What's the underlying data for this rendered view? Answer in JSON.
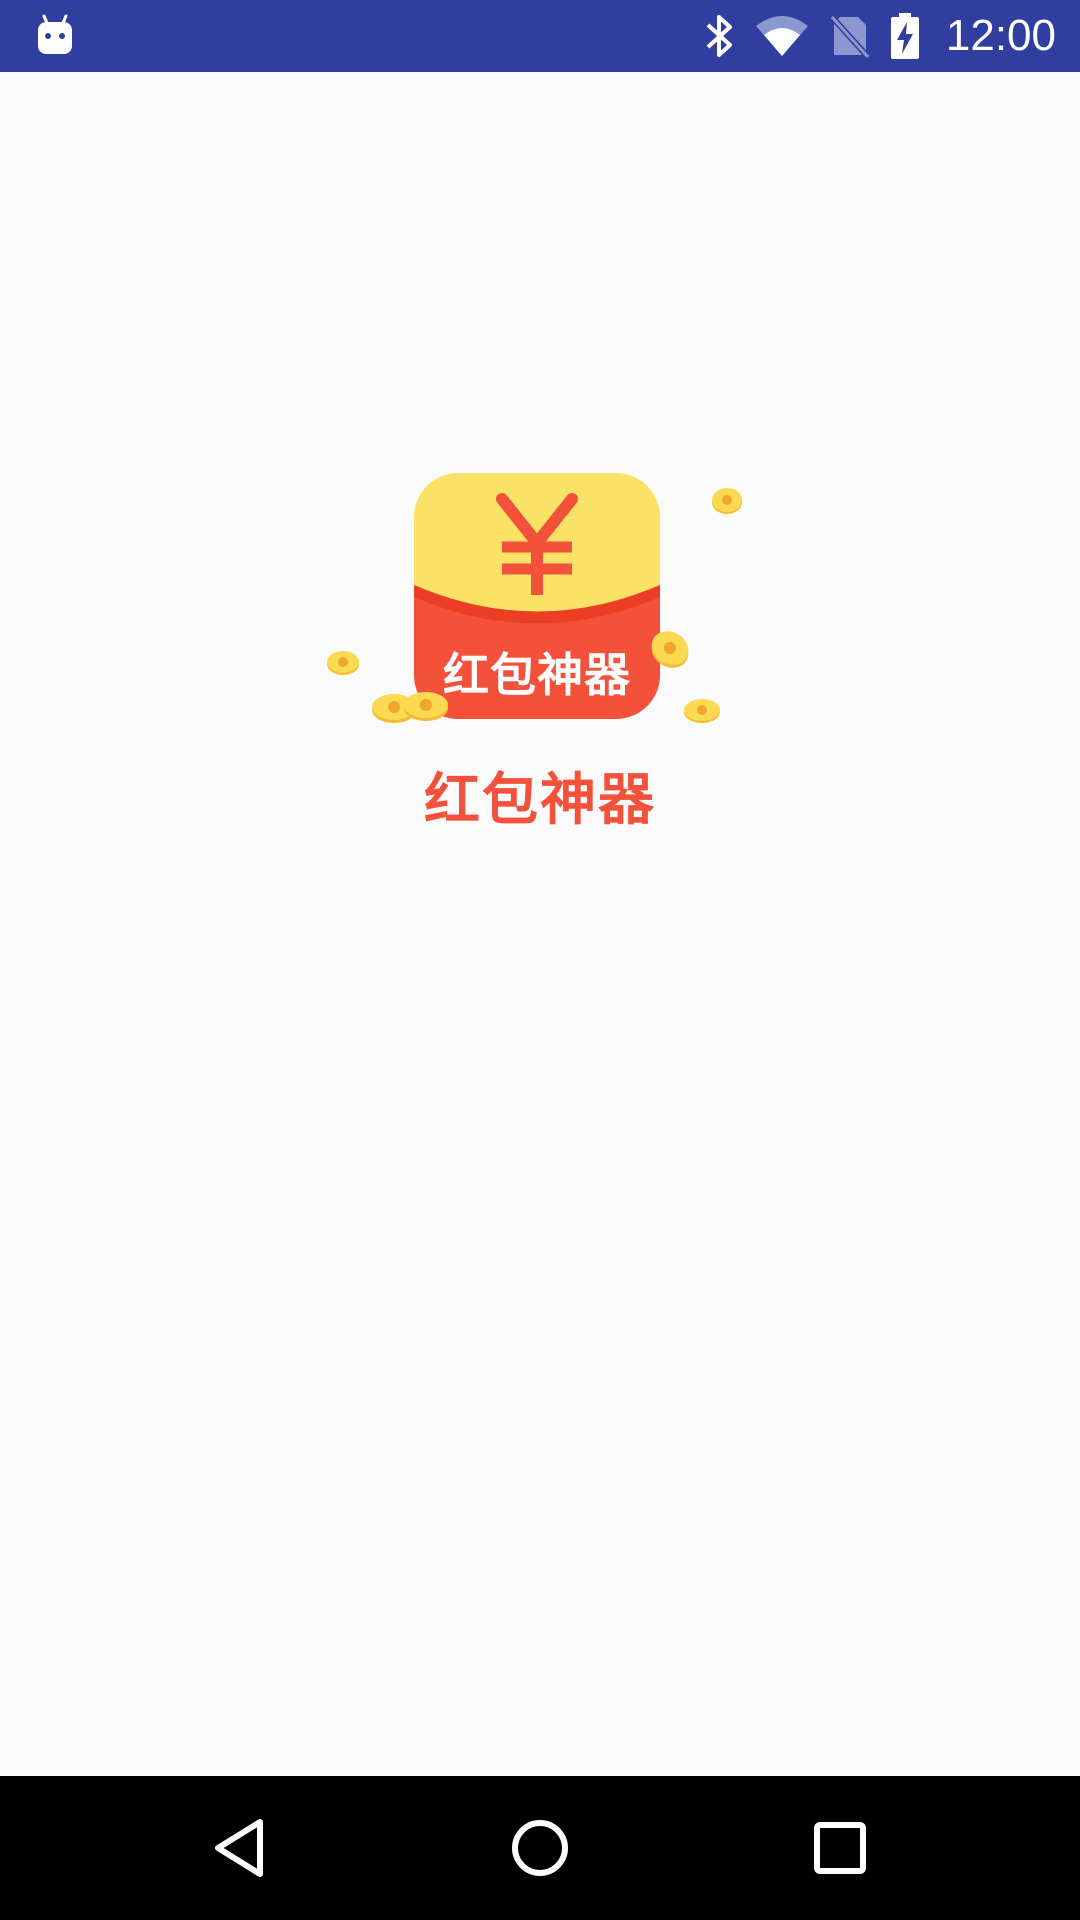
{
  "status_bar": {
    "time": "12:00",
    "background": "#303F9F",
    "icons": [
      "android-notification-icon",
      "bluetooth-icon",
      "wifi-icon",
      "no-sim-icon",
      "battery-charging-icon"
    ]
  },
  "splash": {
    "logo_card_text": "红包神器",
    "logo_symbol": "¥",
    "app_name": "红包神器",
    "accent_red": "#F4513B",
    "accent_yellow": "#F9E265"
  },
  "nav_bar": {
    "buttons": [
      "back-icon",
      "home-icon",
      "recents-icon"
    ]
  }
}
